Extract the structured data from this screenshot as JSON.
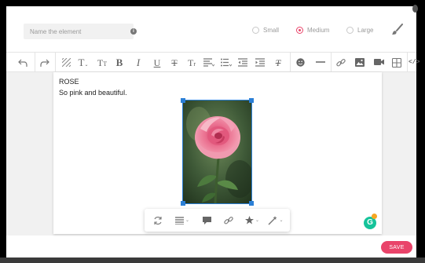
{
  "element_options": {
    "name_placeholder": "Name the element",
    "sizes": [
      {
        "label": "Small",
        "selected": false
      },
      {
        "label": "Medium",
        "selected": true
      },
      {
        "label": "Large",
        "selected": false
      }
    ]
  },
  "toolbar": {
    "icons": [
      "undo-icon",
      "redo-icon",
      "background-pattern-icon",
      "text-color-icon",
      "text-size-icon",
      "bold-icon",
      "italic-icon",
      "underline-icon",
      "strikethrough-icon",
      "text-transform-icon",
      "align-icon",
      "list-icon",
      "outdent-icon",
      "indent-icon",
      "clear-format-icon",
      "emoji-icon",
      "horizontal-rule-icon",
      "link-icon",
      "image-icon",
      "video-icon",
      "table-icon",
      "code-view-icon"
    ]
  },
  "content": {
    "line1": "ROSE",
    "line2": "So pink and beautiful."
  },
  "image_toolbar": {
    "icons": [
      "replace-icon",
      "align-icon",
      "caption-icon",
      "link-icon",
      "style-icon",
      "effects-icon"
    ]
  },
  "footer": {
    "save_label": "SAVE"
  },
  "colors": {
    "accent": "#e9446a",
    "selection": "#2b7fd6",
    "grammarly": "#15c39a"
  }
}
